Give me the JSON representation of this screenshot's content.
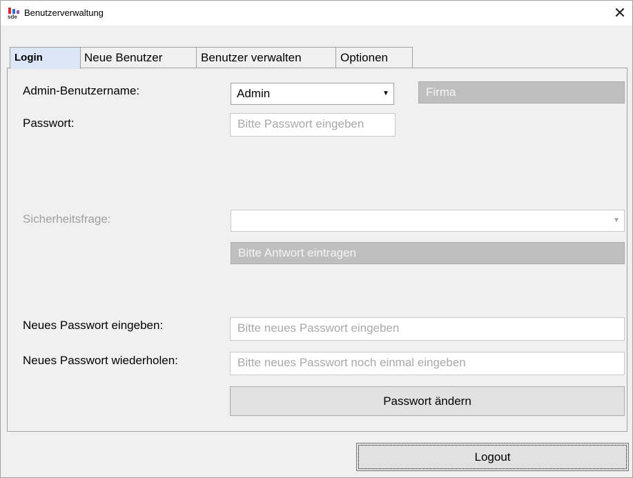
{
  "window": {
    "title": "Benutzerverwaltung"
  },
  "tabs": [
    {
      "label": "Login"
    },
    {
      "label": "Neue Benutzer"
    },
    {
      "label": "Benutzer verwalten"
    },
    {
      "label": "Optionen"
    }
  ],
  "login": {
    "admin_label": "Admin-Benutzername:",
    "admin_value": "Admin",
    "company_placeholder": "Firma",
    "password_label": "Passwort:",
    "password_placeholder": "Bitte Passwort eingeben",
    "security_label": "Sicherheitsfrage:",
    "security_value": "",
    "answer_placeholder": "Bitte Antwort eintragen",
    "new_password_label": "Neues Passwort eingeben:",
    "new_password_placeholder": "Bitte neues Passwort eingeben",
    "repeat_password_label": "Neues Passwort wiederholen:",
    "repeat_password_placeholder": "Bitte neues Passwort noch einmal eingeben",
    "change_button": "Passwort ändern"
  },
  "footer": {
    "logout_button": "Logout"
  },
  "icons": {
    "close": "close-icon",
    "dropdown": "chevron-down-icon",
    "app": "app-logo-icon"
  }
}
